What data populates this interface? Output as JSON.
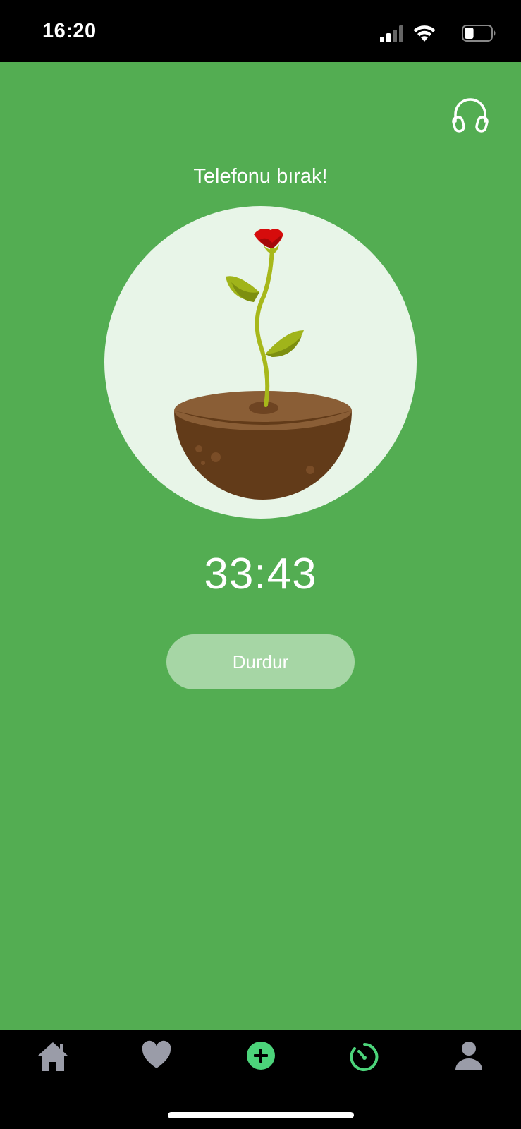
{
  "status_bar": {
    "time": "16:20",
    "icons": [
      "signal-icon",
      "wifi-icon",
      "battery-icon"
    ],
    "battery_level": 0.35
  },
  "main": {
    "background_color": "#53ad52",
    "headphones_icon": "headphones-icon",
    "prompt": "Telefonu bırak!",
    "plant": "rose-sapling-in-soil",
    "timer": "33:43",
    "stop_button_label": "Durdur"
  },
  "tab_bar": {
    "tabs": [
      {
        "icon": "home-icon",
        "active": false
      },
      {
        "icon": "heart-icon",
        "active": false
      },
      {
        "icon": "plus-circle-icon",
        "active": false
      },
      {
        "icon": "timer-icon",
        "active": true
      },
      {
        "icon": "profile-icon",
        "active": false
      }
    ],
    "inactive_color": "#9a9ca8",
    "accent_color": "#4cd37a"
  }
}
